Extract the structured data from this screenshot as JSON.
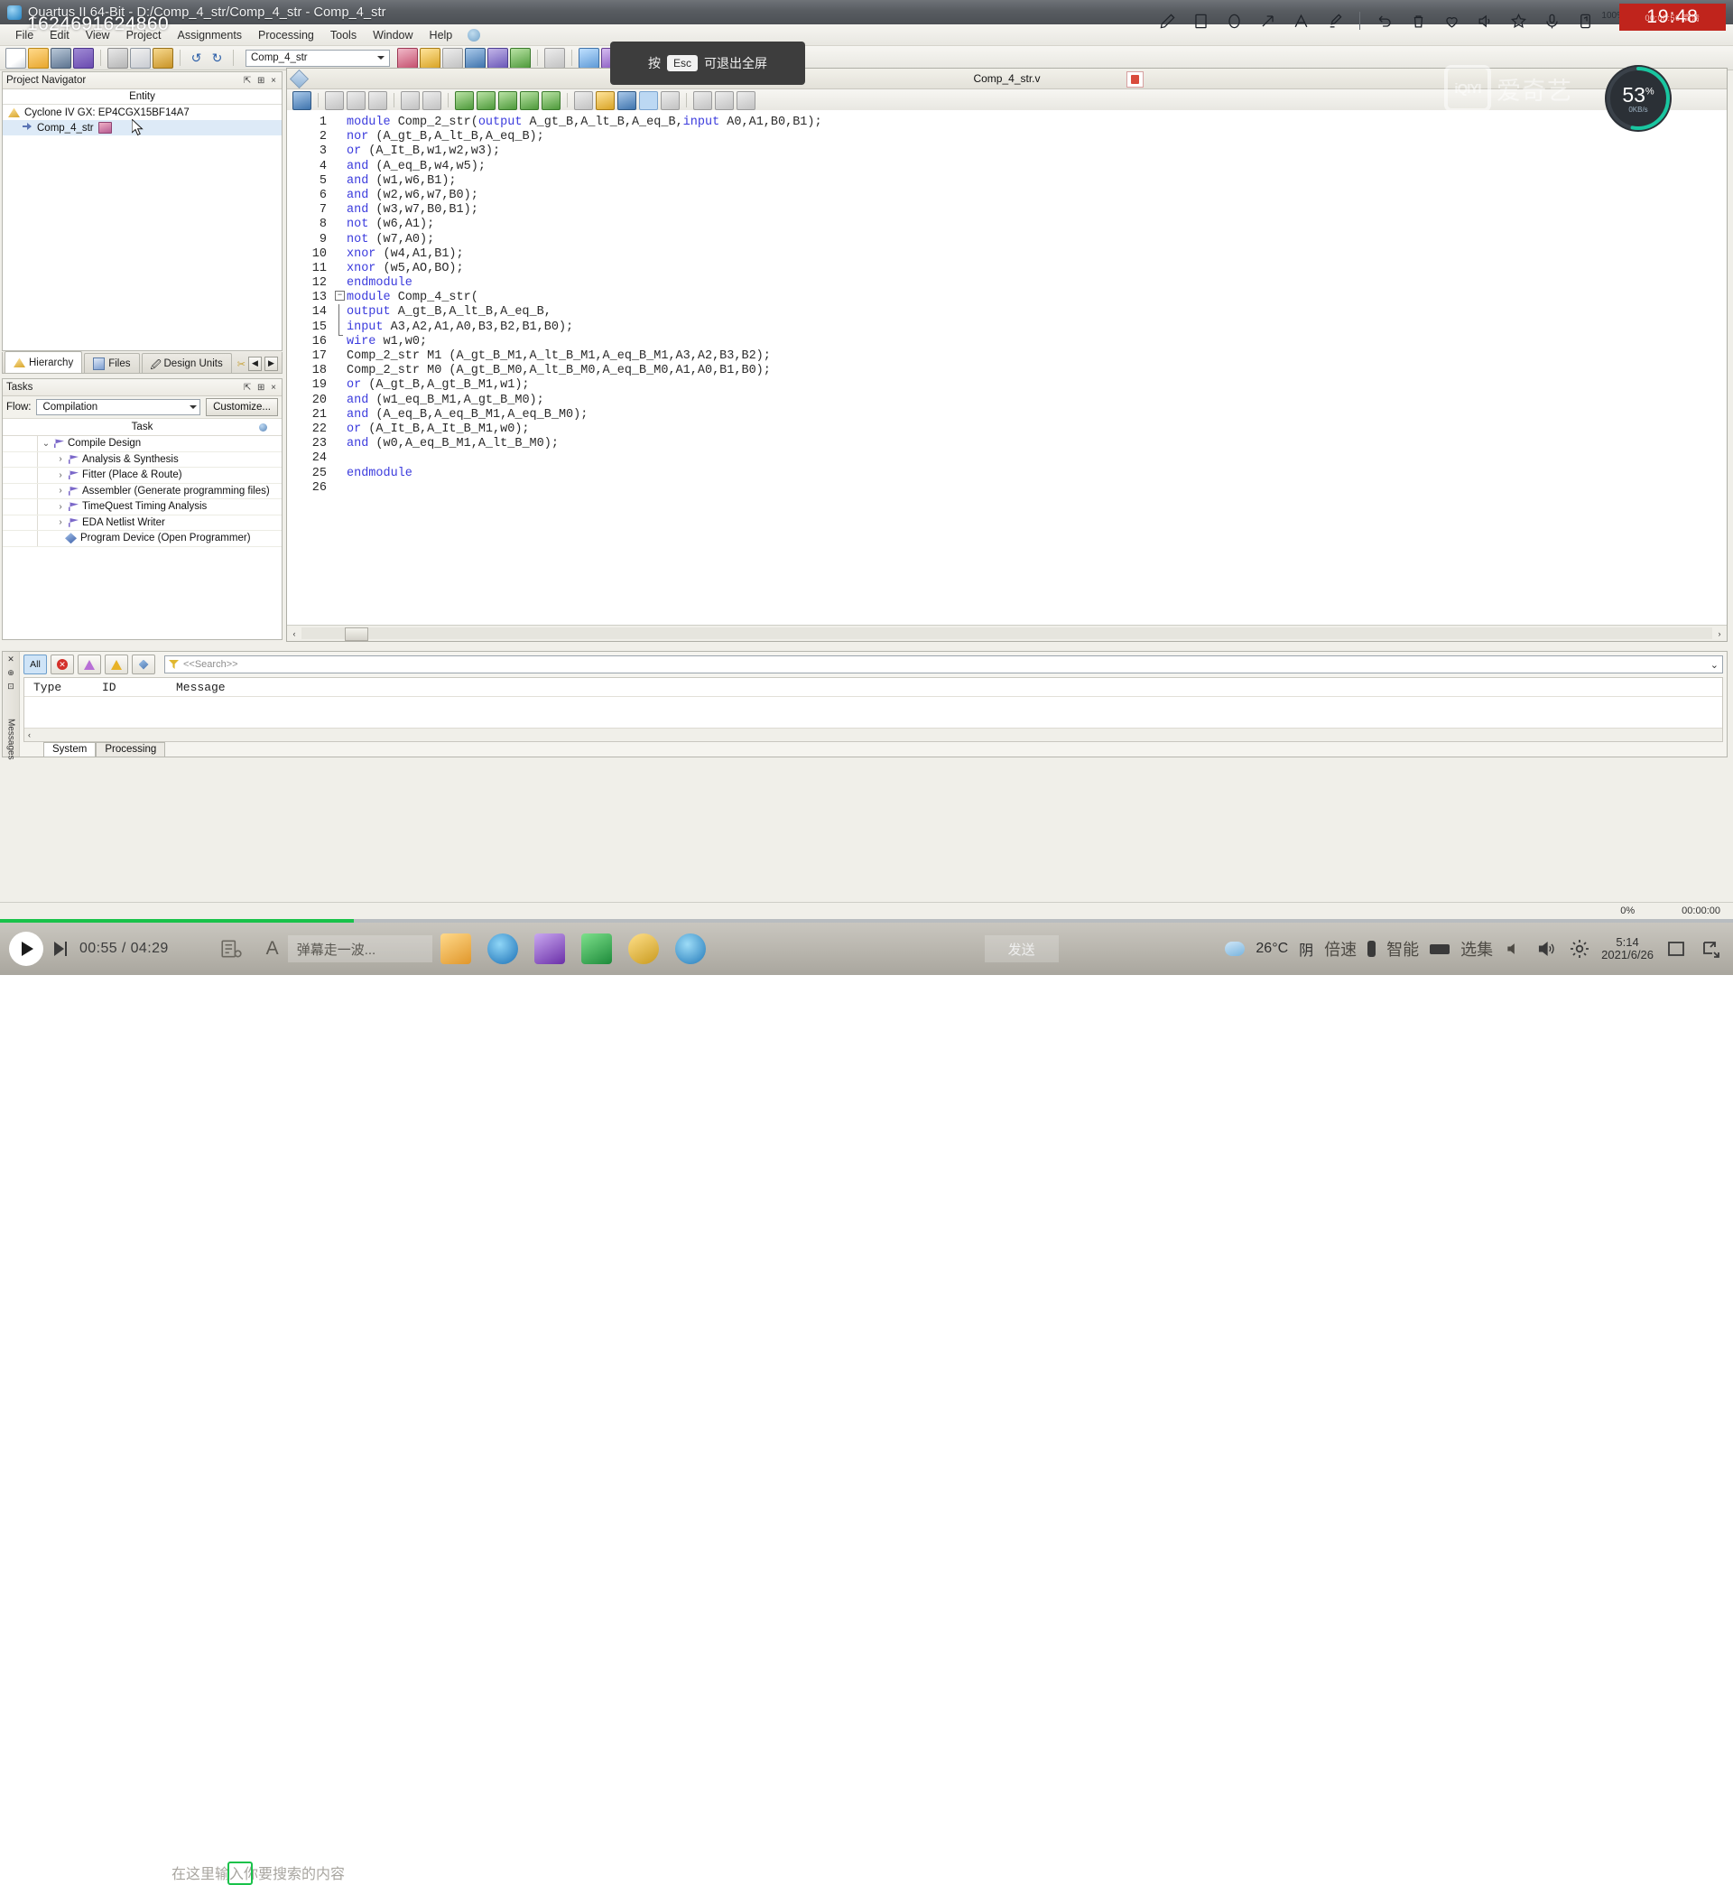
{
  "window": {
    "title": "Quartus II 64-Bit - D:/Comp_4_str/Comp_4_str - Comp_4_str",
    "watermark_number": "1624691624860"
  },
  "menu": {
    "items": [
      "File",
      "Edit",
      "View",
      "Project",
      "Assignments",
      "Processing",
      "Tools",
      "Window",
      "Help"
    ]
  },
  "toolbar": {
    "project_combo_value": "Comp_4_str"
  },
  "project_navigator": {
    "title": "Project Navigator",
    "pin_glyph": "⇱ ⊞ ×",
    "column_header": "Entity",
    "rows": [
      {
        "label": "Cyclone IV GX: EP4CGX15BF14A7",
        "icon": "device-triangle-icon",
        "selected": false
      },
      {
        "label": "Comp_4_str",
        "icon": "entity-arrow-icon",
        "selected": true
      }
    ],
    "tabs": [
      {
        "label": "Hierarchy",
        "icon": "hierarchy-icon",
        "active": true
      },
      {
        "label": "Files",
        "icon": "files-icon",
        "active": false
      },
      {
        "label": "Design Units",
        "icon": "design-units-icon",
        "active": false
      }
    ],
    "tab_nav": [
      "◀",
      "▶"
    ]
  },
  "tasks": {
    "title": "Tasks",
    "pin_glyph": "⇱ ⊞ ×",
    "flow_label": "Flow:",
    "flow_value": "Compilation",
    "customize_label": "Customize...",
    "column_header": "Task",
    "rows": [
      {
        "label": "Compile Design",
        "indent": 0,
        "chevron": "⌄",
        "icon": "flag-icon"
      },
      {
        "label": "Analysis & Synthesis",
        "indent": 1,
        "chevron": "›",
        "icon": "flag-icon"
      },
      {
        "label": "Fitter (Place & Route)",
        "indent": 1,
        "chevron": "›",
        "icon": "flag-icon"
      },
      {
        "label": "Assembler (Generate programming files)",
        "indent": 1,
        "chevron": "›",
        "icon": "flag-icon"
      },
      {
        "label": "TimeQuest Timing Analysis",
        "indent": 1,
        "chevron": "›",
        "icon": "flag-icon"
      },
      {
        "label": "EDA Netlist Writer",
        "indent": 1,
        "chevron": "›",
        "icon": "flag-icon"
      },
      {
        "label": "Program Device (Open Programmer)",
        "indent": 1,
        "chevron": "",
        "icon": "gem-icon"
      }
    ]
  },
  "editor": {
    "tab_name": "Comp_4_str.v",
    "lines": [
      {
        "n": "1",
        "text": "module Comp_2_str(output A_gt_B,A_lt_B,A_eq_B,input A0,A1,B0,B1);",
        "kw": [
          "module",
          "output",
          "input"
        ]
      },
      {
        "n": "2",
        "text": "nor (A_gt_B,A_lt_B,A_eq_B);",
        "kw": [
          "nor"
        ]
      },
      {
        "n": "3",
        "text": "or (A_It_B,w1,w2,w3);",
        "kw": [
          "or"
        ]
      },
      {
        "n": "4",
        "text": "and (A_eq_B,w4,w5);",
        "kw": [
          "and"
        ]
      },
      {
        "n": "5",
        "text": "and (w1,w6,B1);",
        "kw": [
          "and"
        ]
      },
      {
        "n": "6",
        "text": "and (w2,w6,w7,B0);",
        "kw": [
          "and"
        ]
      },
      {
        "n": "7",
        "text": "and (w3,w7,B0,B1);",
        "kw": [
          "and"
        ]
      },
      {
        "n": "8",
        "text": "not (w6,A1);",
        "kw": [
          "not"
        ]
      },
      {
        "n": "9",
        "text": "not (w7,A0);",
        "kw": [
          "not"
        ]
      },
      {
        "n": "10",
        "text": "xnor (w4,A1,B1);",
        "kw": [
          "xnor"
        ]
      },
      {
        "n": "11",
        "text": "xnor (w5,AO,BO);",
        "kw": [
          "xnor"
        ]
      },
      {
        "n": "12",
        "text": "endmodule",
        "kw": [
          "endmodule"
        ]
      },
      {
        "n": "13",
        "text": "module Comp_4_str(",
        "kw": [
          "module"
        ]
      },
      {
        "n": "14",
        "text": "output A_gt_B,A_lt_B,A_eq_B,",
        "kw": [
          "output"
        ]
      },
      {
        "n": "15",
        "text": "input A3,A2,A1,A0,B3,B2,B1,B0);",
        "kw": [
          "input"
        ]
      },
      {
        "n": "16",
        "text": "wire w1,w0;",
        "kw": [
          "wire"
        ]
      },
      {
        "n": "17",
        "text": "Comp_2_str M1 (A_gt_B_M1,A_lt_B_M1,A_eq_B_M1,A3,A2,B3,B2);",
        "kw": []
      },
      {
        "n": "18",
        "text": "Comp_2_str M0 (A_gt_B_M0,A_lt_B_M0,A_eq_B_M0,A1,A0,B1,B0);",
        "kw": []
      },
      {
        "n": "19",
        "text": "or (A_gt_B,A_gt_B_M1,w1);",
        "kw": [
          "or"
        ]
      },
      {
        "n": "20",
        "text": "and (w1_eq_B_M1,A_gt_B_M0);",
        "kw": [
          "and"
        ]
      },
      {
        "n": "21",
        "text": "and (A_eq_B,A_eq_B_M1,A_eq_B_M0);",
        "kw": [
          "and"
        ]
      },
      {
        "n": "22",
        "text": "or (A_It_B,A_It_B_M1,w0);",
        "kw": [
          "or"
        ]
      },
      {
        "n": "23",
        "text": "and (w0,A_eq_B_M1,A_lt_B_M0);",
        "kw": [
          "and"
        ]
      },
      {
        "n": "24",
        "text": "",
        "kw": []
      },
      {
        "n": "25",
        "text": "endmodule",
        "kw": [
          "endmodule"
        ]
      },
      {
        "n": "26",
        "text": "",
        "kw": []
      }
    ]
  },
  "messages": {
    "side_label": "Messages",
    "filters": [
      {
        "label": "All",
        "name": "filter-all",
        "active": true
      },
      {
        "label": "",
        "name": "filter-error",
        "active": false
      },
      {
        "label": "",
        "name": "filter-critical-warning",
        "active": false
      },
      {
        "label": "",
        "name": "filter-warning",
        "active": false
      },
      {
        "label": "",
        "name": "filter-info",
        "active": false
      }
    ],
    "search_placeholder": "<<Search>>",
    "columns": [
      "Type",
      "ID",
      "Message"
    ],
    "tabs": [
      {
        "label": "System",
        "active": true
      },
      {
        "label": "Processing",
        "active": false
      }
    ]
  },
  "status_bar": {
    "percent": "0%",
    "elapsed": "00:00:00"
  },
  "recorder": {
    "tools": [
      "pen-icon",
      "rectangle-icon",
      "ellipse-icon",
      "arrow-icon",
      "text-icon",
      "highlighter-icon",
      "undo-icon",
      "trash-icon",
      "heart-icon",
      "speaker-icon",
      "star-icon",
      "mic-icon",
      "device-icon"
    ],
    "zoom_label": "100%",
    "clock": "19:48",
    "clock_sub": "00:00:56 高清"
  },
  "toast": {
    "prefix": "按",
    "key": "Esc",
    "suffix": "可退出全屏"
  },
  "watermark": {
    "logo_text": "iQIYI",
    "logo_cn": "爱奇艺",
    "ring_percent": "53",
    "ring_unit": "%",
    "ring_sub": "0KB/s"
  },
  "player": {
    "current_time": "00:55",
    "separator": "/",
    "total_time": "04:29",
    "comment_placeholder": "在这里输入你要搜索的内容",
    "danmu_text": "弹幕走一波...",
    "send_label": "发送",
    "font_glyph": "A"
  },
  "tray": {
    "weather_temp": "26°C",
    "weather_desc": "阴",
    "speed_label": "倍速",
    "smart_label": "智能",
    "episodes_label": "选集",
    "clock_time": "5:14",
    "clock_date": "2021/6/26"
  }
}
